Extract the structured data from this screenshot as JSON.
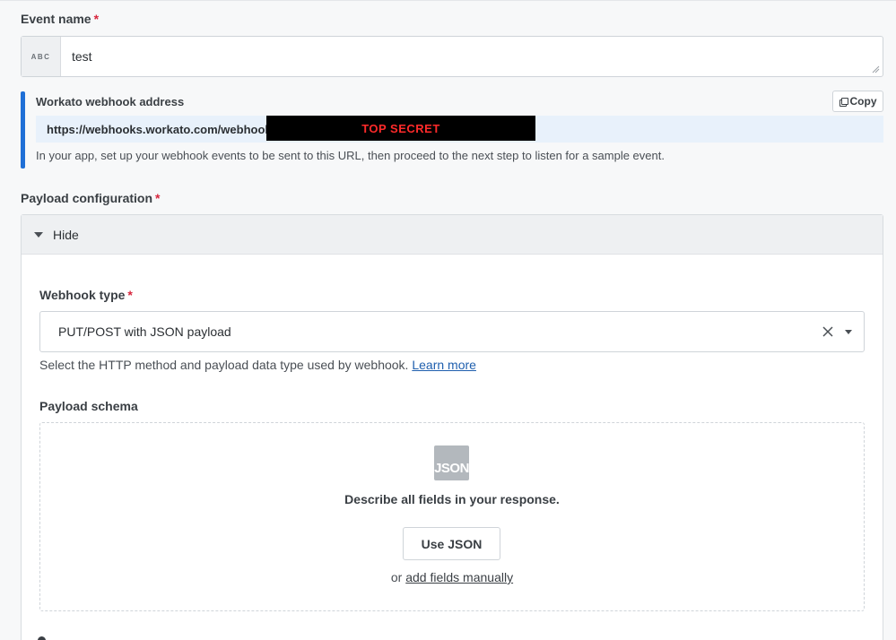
{
  "event_name": {
    "label": "Event name",
    "required_mark": "*",
    "type_badge": "ABC",
    "value": "test"
  },
  "webhook": {
    "label": "Workato webhook address",
    "copy_label": "Copy",
    "url": "https://webhooks.workato.com/webhooks/",
    "redacted_text": "TOP SECRET",
    "help": "In your app, set up your webhook events to be sent to this URL, then proceed to the next step to listen for a sample event."
  },
  "payload_config": {
    "label": "Payload configuration",
    "required_mark": "*",
    "toggle_label": "Hide",
    "webhook_type": {
      "label": "Webhook type",
      "required_mark": "*",
      "selected": "PUT/POST with JSON payload",
      "help": "Select the HTTP method and payload data type used by webhook.",
      "learn_more": "Learn more"
    },
    "schema": {
      "label": "Payload schema",
      "icon_text": "JSON",
      "describe": "Describe all fields in your response.",
      "use_json": "Use JSON",
      "or_text": "or",
      "manual_link": "add fields manually"
    }
  },
  "colors": {
    "accent": "#1f6fd6",
    "required": "#d7263d",
    "link": "#1f5fae",
    "url_bg": "#e8f1fb"
  }
}
